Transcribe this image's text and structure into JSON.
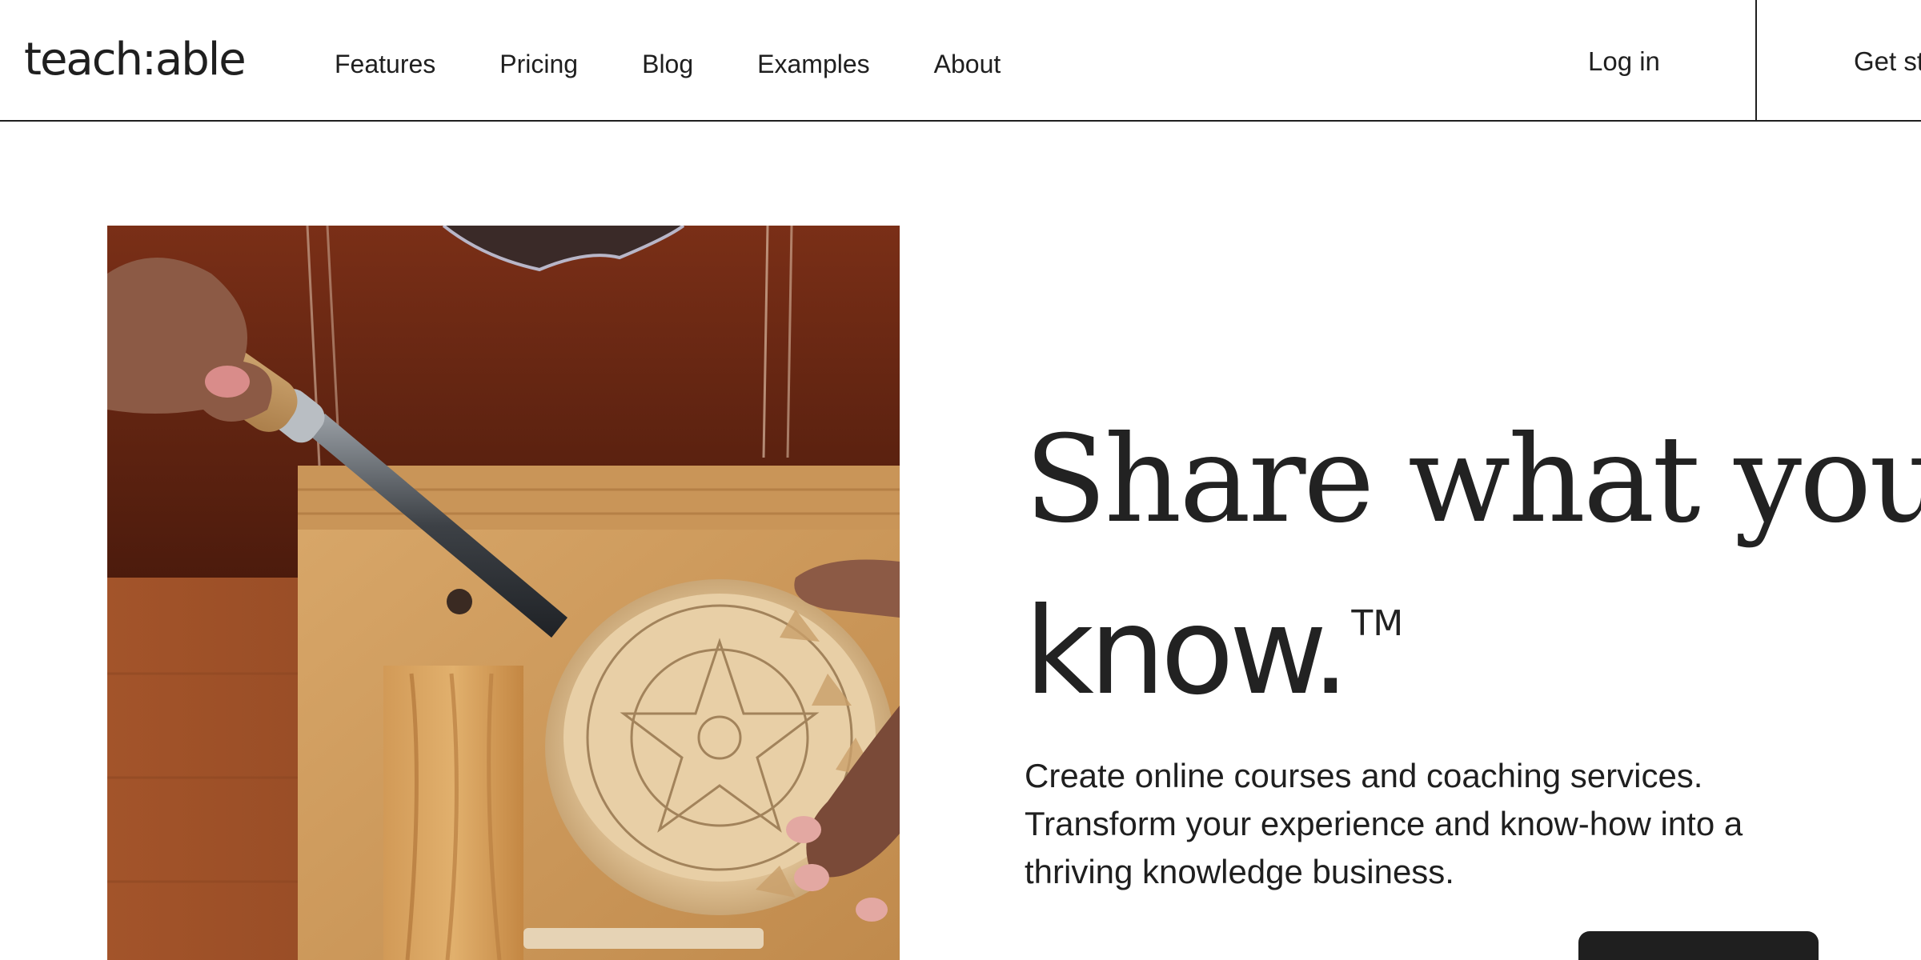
{
  "header": {
    "logo": "teach:able",
    "nav": [
      {
        "label": "Features"
      },
      {
        "label": "Pricing"
      },
      {
        "label": "Blog"
      },
      {
        "label": "Examples"
      },
      {
        "label": "About"
      }
    ],
    "login_label": "Log in",
    "get_started_label": "Get st"
  },
  "hero": {
    "headline_line1": "Share what you",
    "headline_line2": "know.",
    "trademark": "TM",
    "subtext": "Create online courses and coaching services. Transform your experience and know-how into a thriving knowledge business."
  },
  "colors": {
    "text": "#1f1f1f",
    "background": "#ffffff",
    "button": "#1f1f1f"
  }
}
